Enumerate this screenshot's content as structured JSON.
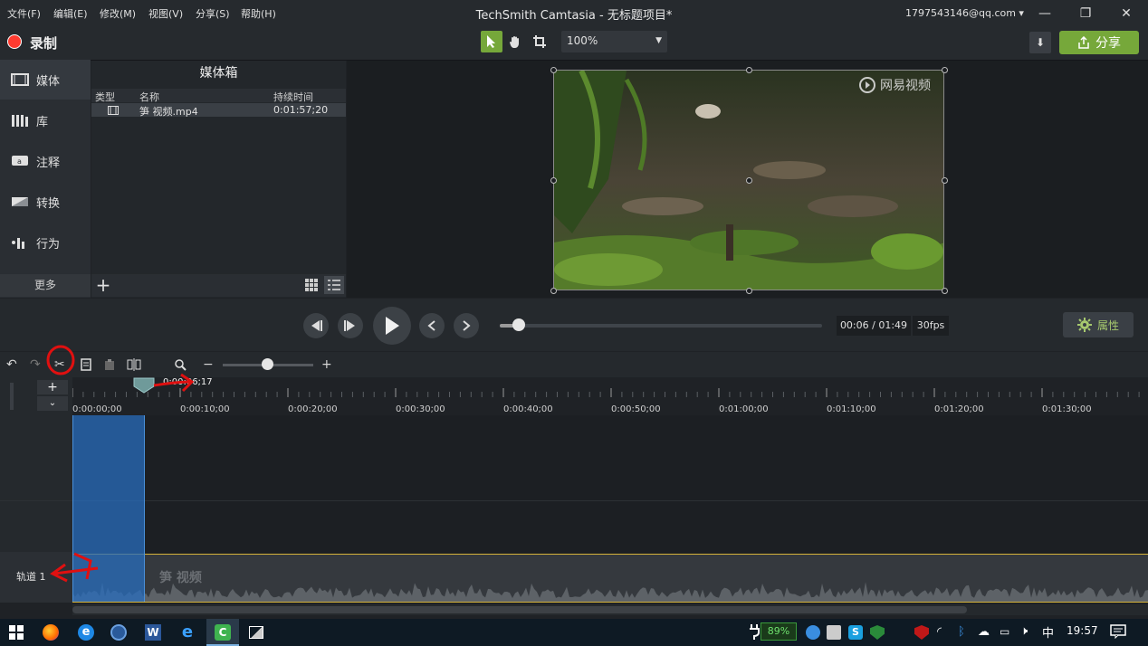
{
  "menu": [
    "文件(F)",
    "编辑(E)",
    "修改(M)",
    "视图(V)",
    "分享(S)",
    "帮助(H)"
  ],
  "app_title": "TechSmith Camtasia - 无标题项目*",
  "account": "1797543146@qq.com ▾",
  "toolbar": {
    "record_label": "录制",
    "zoom_value": "100%",
    "share_label": "分享"
  },
  "sidebar": {
    "items": [
      {
        "label": "媒体",
        "icon": "film-icon"
      },
      {
        "label": "库",
        "icon": "library-icon"
      },
      {
        "label": "注释",
        "icon": "annotation-icon"
      },
      {
        "label": "转换",
        "icon": "transition-icon"
      },
      {
        "label": "行为",
        "icon": "behavior-icon"
      }
    ],
    "more_label": "更多"
  },
  "media_bin": {
    "title": "媒体箱",
    "columns": [
      "类型",
      "名称",
      "持续时间"
    ],
    "rows": [
      {
        "name": "笋 视频.mp4",
        "duration": "0:01:57;20"
      }
    ]
  },
  "preview": {
    "watermark": "网易视频"
  },
  "playback": {
    "timecode": "00:06 / 01:49",
    "fps": "30fps",
    "progress": 0.06,
    "properties_label": "属性"
  },
  "timeline": {
    "playhead_time": "0:00:06;17",
    "ticks": [
      "0:00:00;00",
      "0:00:10;00",
      "0:00:20;00",
      "0:00:30;00",
      "0:00:40;00",
      "0:00:50;00",
      "0:01:00;00",
      "0:01:10;00",
      "0:01:20;00",
      "0:01:30;00"
    ],
    "track1_label": "轨道 1",
    "clip_name": "笋 视频"
  },
  "taskbar": {
    "battery": "89%",
    "ime": "中",
    "time": "19:57"
  },
  "colors": {
    "accent_green": "#76a83a",
    "record_red": "#ff3b30",
    "selection_blue": "#286ebe"
  }
}
